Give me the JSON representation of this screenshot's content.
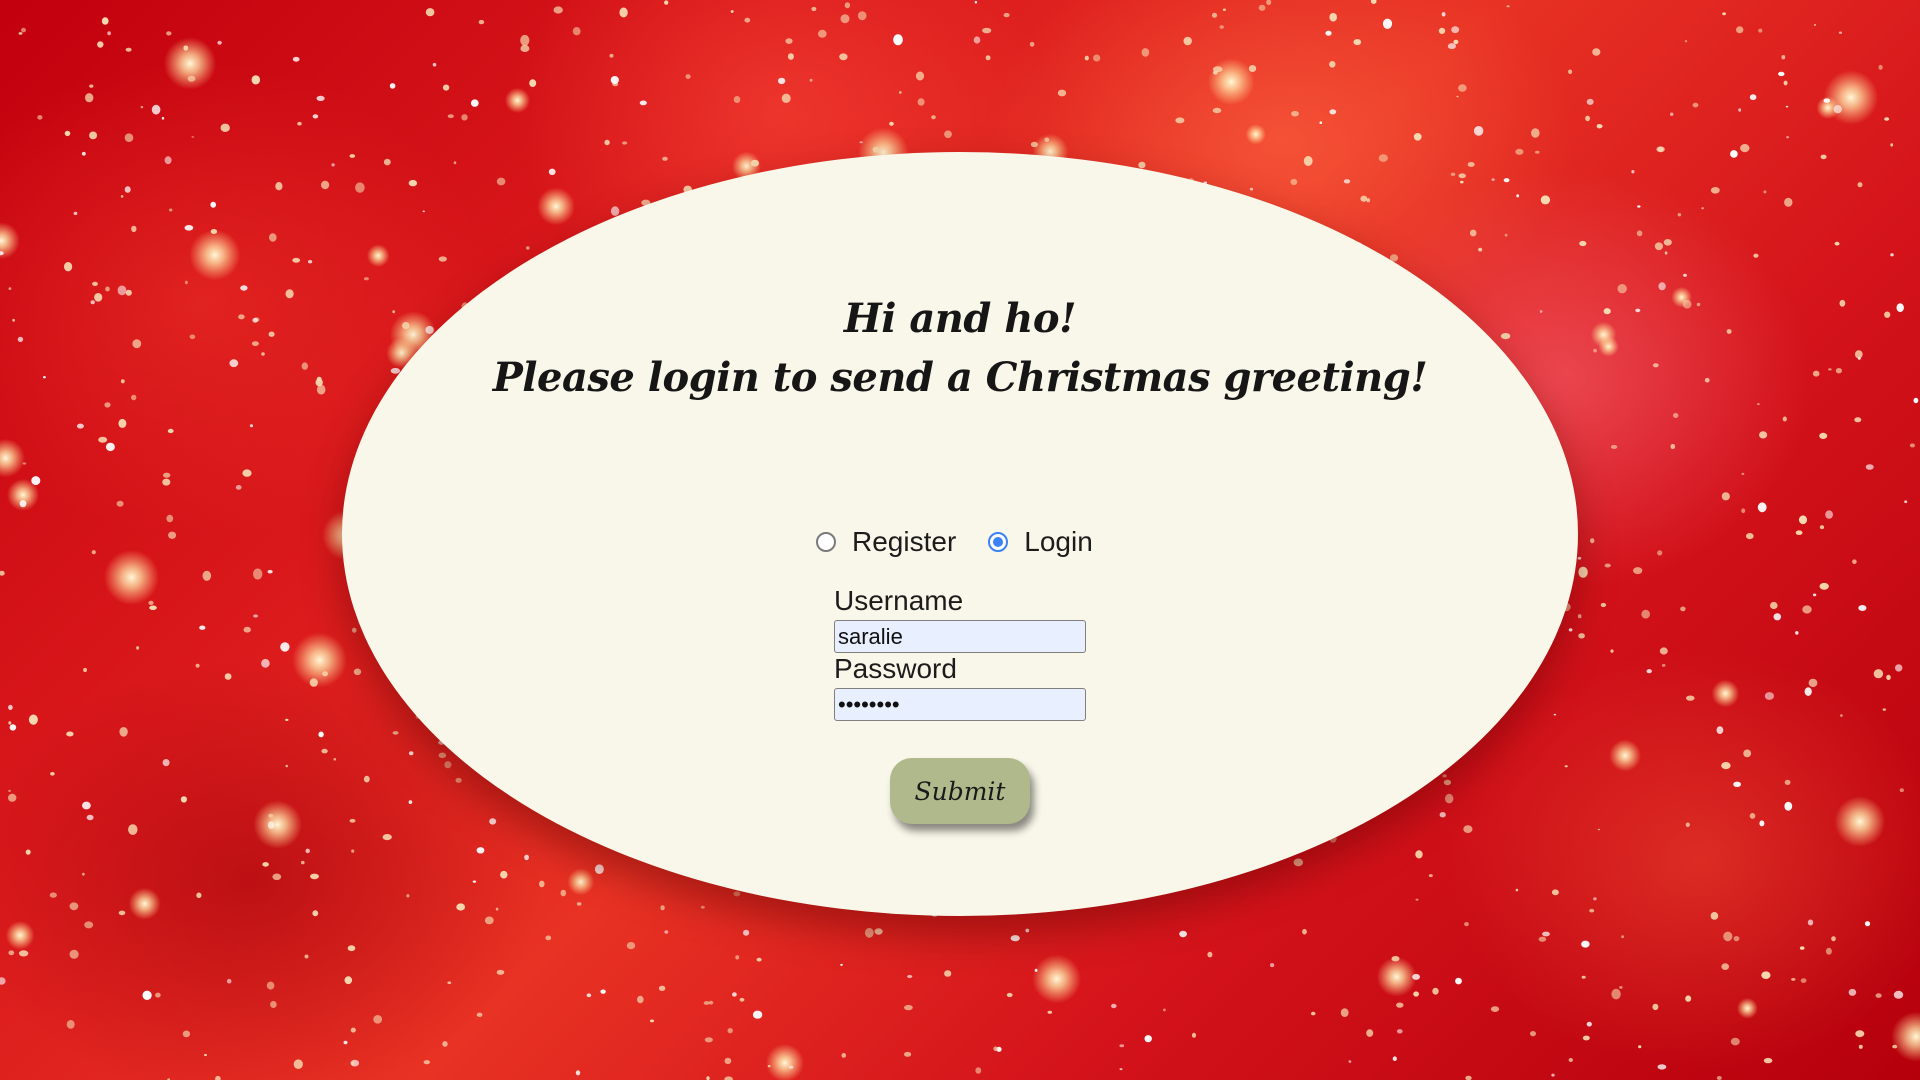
{
  "page": {
    "background_color": "#d3121a",
    "card_color": "#f9f7e9"
  },
  "greeting": {
    "line1": "Hi and ho!",
    "line2": "Please login to send a Christmas greeting!"
  },
  "mode": {
    "options": [
      {
        "label": "Register",
        "checked": false
      },
      {
        "label": "Login",
        "checked": true
      }
    ],
    "accent_color": "#3b82f6"
  },
  "form": {
    "username_label": "Username",
    "username_value": "saralie",
    "password_label": "Password",
    "password_value": "••••••••",
    "input_background": "#e8effe"
  },
  "submit": {
    "label": "Submit",
    "color": "#b0b98b"
  }
}
